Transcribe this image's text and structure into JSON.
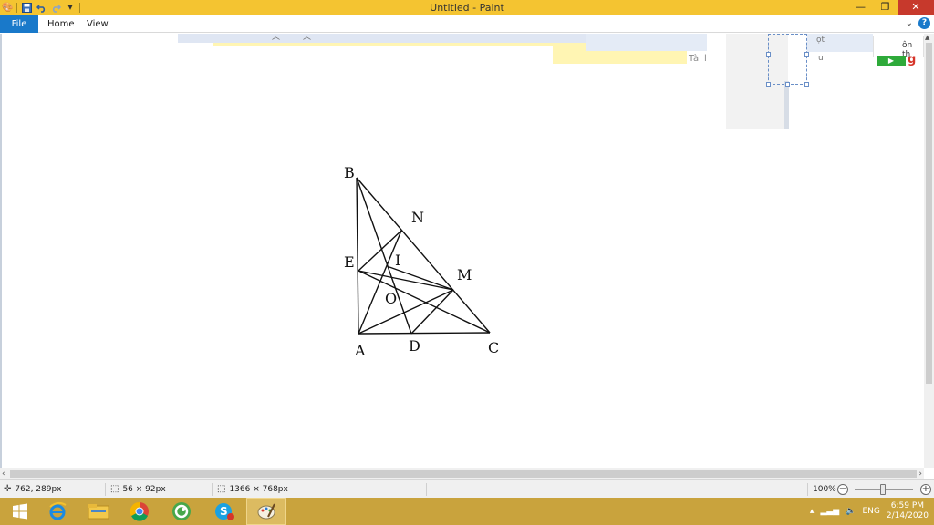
{
  "window": {
    "title": "Untitled - Paint",
    "controls": {
      "minimize": "—",
      "maximize": "❐",
      "close": "✕"
    }
  },
  "ribbon": {
    "tabs": [
      "File",
      "Home",
      "View"
    ],
    "collapse_icon": "chevron-down-icon",
    "help_icon": "?"
  },
  "canvas_fragments": {
    "tai": "Tài l",
    "ot": "ọt",
    "u": "u",
    "onth": "ôn th"
  },
  "figure": {
    "labels": {
      "B": "B",
      "N": "N",
      "E": "E",
      "I": "I",
      "M": "M",
      "O": "O",
      "A": "A",
      "D": "D",
      "C": "C"
    }
  },
  "status": {
    "cursor_pos": "762, 289px",
    "selection_size": "56 × 92px",
    "image_size": "1366 × 768px",
    "zoom": "100%"
  },
  "taskbar": {
    "apps": [
      "start",
      "internet-explorer",
      "file-explorer",
      "chrome",
      "coccoc",
      "skype",
      "paint"
    ],
    "active_app": "paint",
    "language": "ENG",
    "time": "6:59 PM",
    "date": "2/14/2020"
  },
  "colors": {
    "titlebar": "#f4c431",
    "file_tab": "#1979ca",
    "taskbar": "#c9a33d",
    "close": "#c7392c"
  }
}
